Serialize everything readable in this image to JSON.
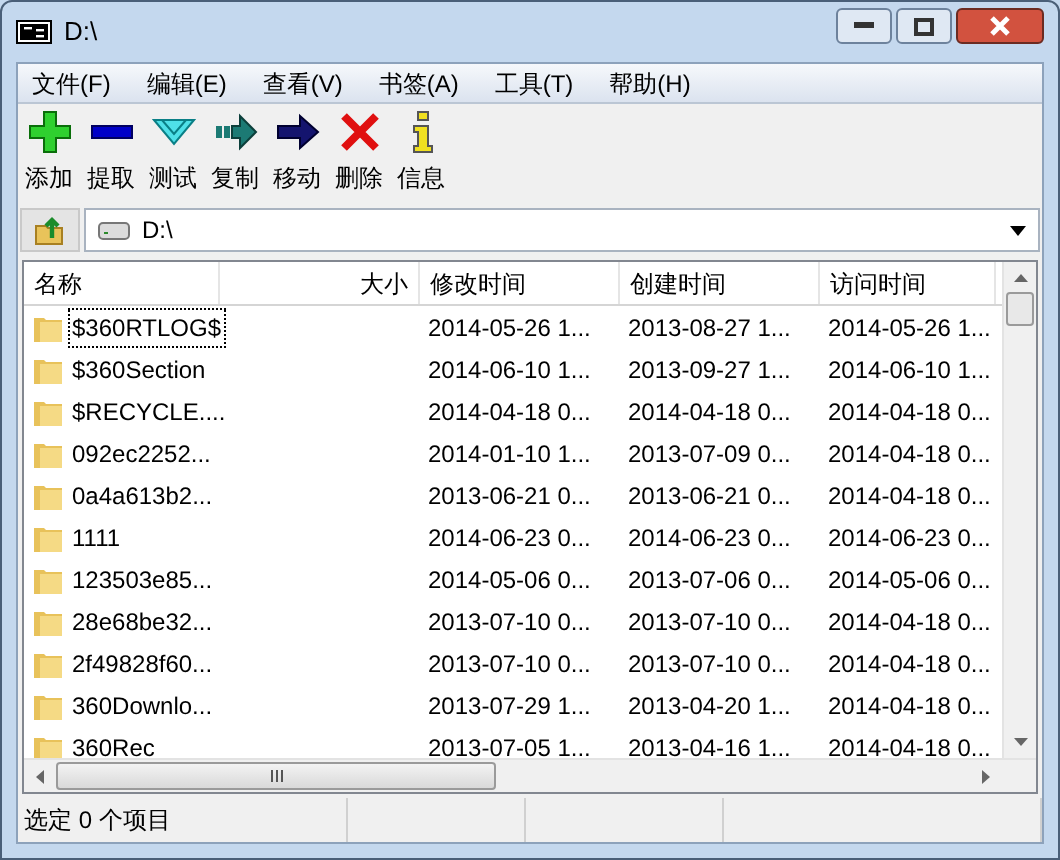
{
  "window": {
    "title": "D:\\"
  },
  "menu": [
    "文件(F)",
    "编辑(E)",
    "查看(V)",
    "书签(A)",
    "工具(T)",
    "帮助(H)"
  ],
  "toolbar": [
    {
      "kind": "add",
      "label": "添加"
    },
    {
      "kind": "extract",
      "label": "提取"
    },
    {
      "kind": "test",
      "label": "测试"
    },
    {
      "kind": "copy",
      "label": "复制"
    },
    {
      "kind": "move",
      "label": "移动"
    },
    {
      "kind": "delete",
      "label": "删除"
    },
    {
      "kind": "info",
      "label": "信息"
    }
  ],
  "address": {
    "value": "D:\\"
  },
  "table": {
    "columns": [
      "名称",
      "大小",
      "修改时间",
      "创建时间",
      "访问时间"
    ],
    "rows": [
      {
        "name": "$360RTLOG$",
        "size": "",
        "modified": "2014-05-26 1...",
        "created": "2013-08-27 1...",
        "accessed": "2014-05-26 1...",
        "focused": true
      },
      {
        "name": "$360Section",
        "size": "",
        "modified": "2014-06-10 1...",
        "created": "2013-09-27 1...",
        "accessed": "2014-06-10 1...",
        "focused": false
      },
      {
        "name": "$RECYCLE....",
        "size": "",
        "modified": "2014-04-18 0...",
        "created": "2014-04-18 0...",
        "accessed": "2014-04-18 0...",
        "focused": false
      },
      {
        "name": "092ec2252...",
        "size": "",
        "modified": "2014-01-10 1...",
        "created": "2013-07-09 0...",
        "accessed": "2014-04-18 0...",
        "focused": false
      },
      {
        "name": "0a4a613b2...",
        "size": "",
        "modified": "2013-06-21 0...",
        "created": "2013-06-21 0...",
        "accessed": "2014-04-18 0...",
        "focused": false
      },
      {
        "name": "1111",
        "size": "",
        "modified": "2014-06-23 0...",
        "created": "2014-06-23 0...",
        "accessed": "2014-06-23 0...",
        "focused": false
      },
      {
        "name": "123503e85...",
        "size": "",
        "modified": "2014-05-06 0...",
        "created": "2013-07-06 0...",
        "accessed": "2014-05-06 0...",
        "focused": false
      },
      {
        "name": "28e68be32...",
        "size": "",
        "modified": "2013-07-10 0...",
        "created": "2013-07-10 0...",
        "accessed": "2014-04-18 0...",
        "focused": false
      },
      {
        "name": "2f49828f60...",
        "size": "",
        "modified": "2013-07-10 0...",
        "created": "2013-07-10 0...",
        "accessed": "2014-04-18 0...",
        "focused": false
      },
      {
        "name": "360Downlo...",
        "size": "",
        "modified": "2013-07-29 1...",
        "created": "2013-04-20 1...",
        "accessed": "2014-04-18 0...",
        "focused": false
      },
      {
        "name": "360Rec",
        "size": "",
        "modified": "2013-07-05 1...",
        "created": "2013-04-16 1...",
        "accessed": "2014-04-18 0...",
        "focused": false
      }
    ]
  },
  "status_bar": [
    "选定 0 个项目"
  ]
}
